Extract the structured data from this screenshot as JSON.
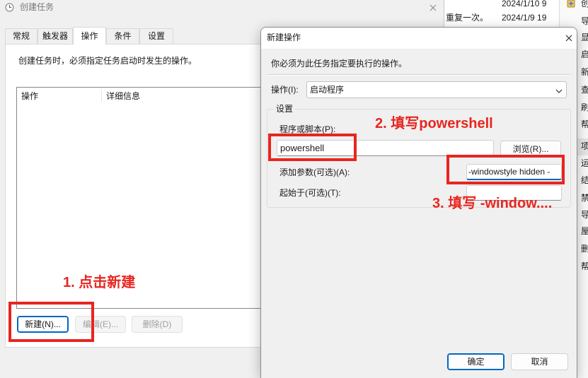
{
  "colors": {
    "annotation": "#e8251f",
    "accent": "#0067c0"
  },
  "task_list": {
    "rows": [
      {
        "next_run": "2024/1/10 9"
      },
      {
        "trigger": "重复一次。",
        "next_run": "2024/1/9 19"
      }
    ]
  },
  "actions_pane": {
    "items": [
      "创",
      "导",
      "显",
      "启",
      "新",
      "查",
      "刷",
      "帮",
      "项",
      "运",
      "结",
      "禁",
      "导",
      "屋",
      "删",
      "帮"
    ]
  },
  "create_task": {
    "title": "创建任务",
    "tabs": [
      "常规",
      "触发器",
      "操作",
      "条件",
      "设置"
    ],
    "description": "创建任务时，必须指定任务启动时发生的操作。",
    "columns": [
      "操作",
      "详细信息"
    ],
    "new_button": "新建(N)...",
    "edit_button": "编辑(E)...",
    "delete_button": "删除(D)"
  },
  "new_action": {
    "title": "新建操作",
    "description": "你必须为此任务指定要执行的操作。",
    "action_label": "操作(I):",
    "action_value": "启动程序",
    "settings_group": "设置",
    "program_label": "程序或脚本(P):",
    "program_value": "powershell",
    "browse_button": "浏览(R)...",
    "arguments_label": "添加参数(可选)(A):",
    "arguments_value": "-windowstyle hidden -",
    "start_in_label": "起始于(可选)(T):",
    "ok_button": "确定",
    "cancel_button": "取消"
  },
  "annotations": {
    "step1": "1. 点击新建",
    "step2": "2. 填写powershell",
    "step3": "3. 填写 -window...."
  }
}
